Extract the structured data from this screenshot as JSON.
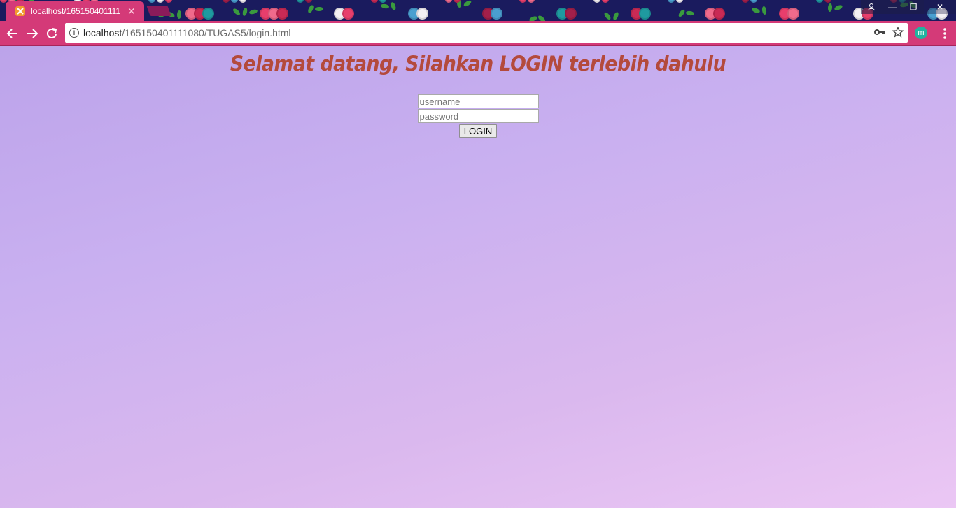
{
  "browser": {
    "tab": {
      "title": "localhost/165150401111",
      "close_glyph": "✕",
      "favicon": "xampp-icon"
    },
    "window_controls": {
      "user_glyph": "👤",
      "minimize_glyph": "—",
      "restore_glyph": "❐",
      "close_glyph": "✕"
    },
    "nav": {
      "back_glyph": "←",
      "forward_glyph": "→",
      "reload_glyph": "↻"
    },
    "address_bar": {
      "info_glyph": "i",
      "url_host": "localhost",
      "url_path": "/165150401111080/TUGAS5/login.html",
      "key_glyph": "⚿",
      "star_glyph": "☆"
    },
    "profile_initial": "m",
    "menu_glyph": "⋮",
    "accent_color": "#d43a78"
  },
  "page": {
    "heading": "Selamat datang, Silahkan LOGIN terlebih dahulu",
    "heading_color": "#b44a3c",
    "form": {
      "username_placeholder": "username",
      "password_placeholder": "password",
      "username_value": "",
      "password_value": "",
      "login_label": "LOGIN"
    }
  }
}
